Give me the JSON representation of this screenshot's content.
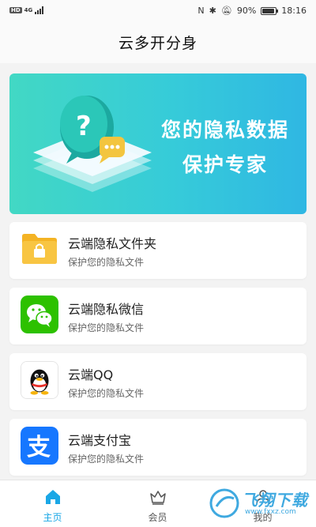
{
  "status_bar": {
    "hd": "HD",
    "network": "4G",
    "battery_text": "90%",
    "battery_level": 0.9,
    "time": "18:16",
    "icons": [
      "nfc-icon",
      "bluetooth-icon",
      "mute-icon",
      "signal-icon",
      "battery-icon"
    ]
  },
  "header": {
    "title": "云多开分身"
  },
  "banner": {
    "line1": "您的隐私数据",
    "line2": "保护专家",
    "gradient": [
      "#42d8c4",
      "#2fb7e3"
    ]
  },
  "items": [
    {
      "title": "云端隐私文件夹",
      "subtitle": "保护您的隐私文件",
      "icon": "folder-lock-icon"
    },
    {
      "title": "云端隐私微信",
      "subtitle": "保护您的隐私文件",
      "icon": "wechat-icon"
    },
    {
      "title": "云端QQ",
      "subtitle": "保护您的隐私文件",
      "icon": "qq-icon"
    },
    {
      "title": "云端支付宝",
      "subtitle": "保护您的隐私文件",
      "icon": "alipay-icon"
    }
  ],
  "tabs": [
    {
      "label": "主页",
      "icon": "home-icon",
      "active": true
    },
    {
      "label": "会员",
      "icon": "crown-icon",
      "active": false
    },
    {
      "label": "我的",
      "icon": "user-icon",
      "active": false
    }
  ],
  "watermark": {
    "text": "飞翔下载",
    "sub": "www.fxxz.com"
  },
  "colors": {
    "accent": "#1aa7e6",
    "background": "#f3f3f3"
  }
}
